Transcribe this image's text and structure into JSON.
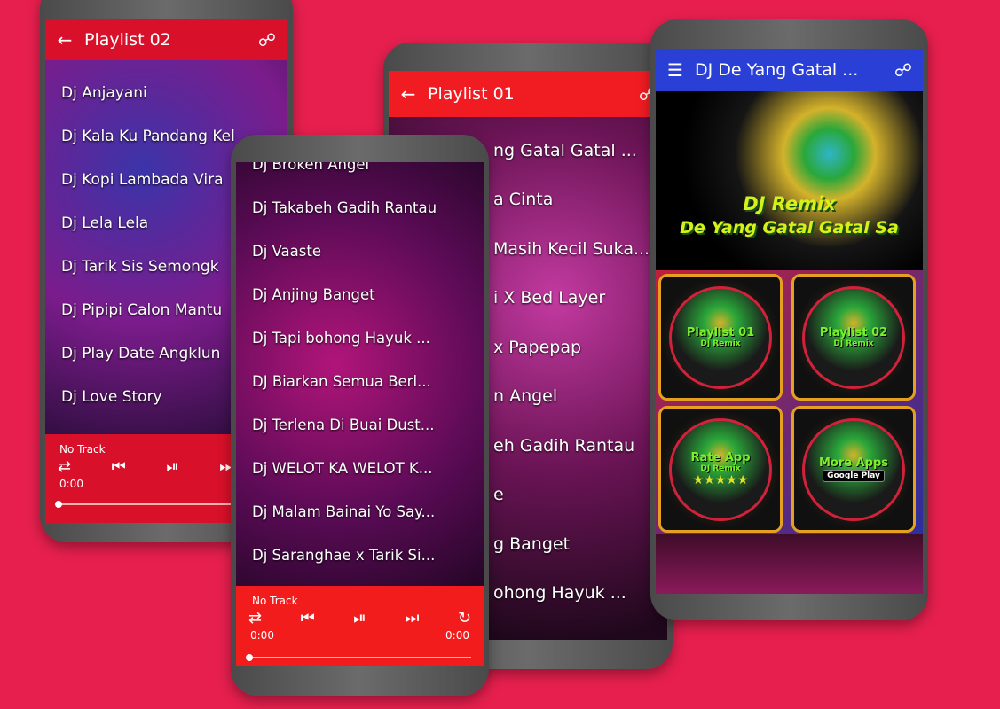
{
  "colors": {
    "background": "#e61f4e",
    "red_header": "#e8141f",
    "blue_header": "#2a3fd6"
  },
  "phone_playlist02": {
    "title": "Playlist 02",
    "back_icon": "arrow-left",
    "share_icon": "share",
    "items": [
      "Dj Anjayani",
      "Dj Kala Ku Pandang Kel",
      "Dj Kopi Lambada Vira",
      "Dj Lela Lela",
      "Dj Tarik Sis Semongk",
      "Dj Pipipi Calon Mantu",
      "Dj Play Date Angklun",
      "Dj Love Story"
    ],
    "player": {
      "track": "No Track",
      "time": "0:00",
      "progress": 0
    }
  },
  "phone_playlist01": {
    "title": "Playlist 01",
    "items": [
      "ng Gatal Gatal ...",
      "a Cinta",
      "Masih Kecil Suka...",
      "i X Bed Layer",
      "x Papepap",
      "n Angel",
      "eh Gadih Rantau",
      "e",
      "g Banget",
      "ohong Hayuk ..."
    ]
  },
  "phone_playlist_front": {
    "items": [
      "Dj Broken Angel",
      "Dj Takabeh Gadih Rantau",
      "Dj Vaaste",
      "Dj Anjing Banget",
      "Dj Tapi bohong Hayuk ...",
      "DJ Biarkan Semua Berl...",
      "Dj Terlena Di Buai Dust...",
      "Dj WELOT KA WELOT K...",
      "Dj Malam Bainai Yo Say...",
      "Dj Saranghae x Tarik Si..."
    ],
    "player": {
      "track": "No Track",
      "time_elapsed": "0:00",
      "time_total": "0:00",
      "progress": 0
    }
  },
  "phone_home": {
    "title": "DJ De Yang Gatal ...",
    "menu_icon": "hamburger",
    "banner": {
      "line1": "DJ Remix",
      "line2": "De Yang Gatal Gatal Sa"
    },
    "tiles": [
      {
        "label": "Playlist 01",
        "sub": "DJ Remix"
      },
      {
        "label": "Playlist 02",
        "sub": "DJ Remix"
      },
      {
        "label": "Rate App",
        "sub": "DJ Remix",
        "stars": 5
      },
      {
        "label": "More Apps",
        "sub": "Google Play"
      }
    ]
  }
}
